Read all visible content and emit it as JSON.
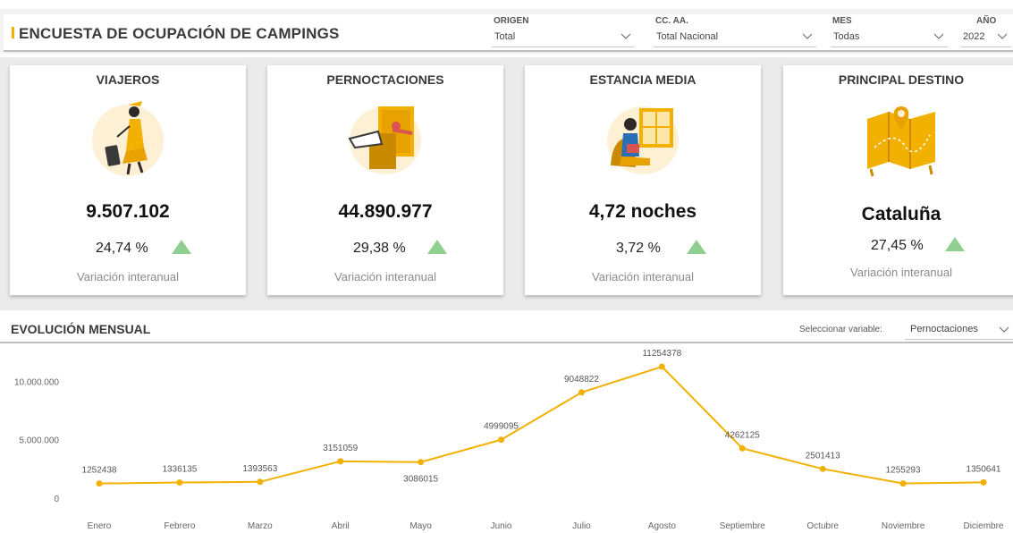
{
  "header": {
    "title": "ENCUESTA DE OCUPACIÓN DE CAMPINGS",
    "accent_color": "#F2B000"
  },
  "filters": {
    "origen": {
      "label": "ORIGEN",
      "value": "Total"
    },
    "ccaa": {
      "label": "CC. AA.",
      "value": "Total Nacional"
    },
    "mes": {
      "label": "MES",
      "value": "Todas"
    },
    "anio": {
      "label": "AÑO",
      "value": "2022"
    }
  },
  "kpis": [
    {
      "title": "VIAJEROS",
      "icon": "traveler-illustration",
      "value": "9.507.102",
      "pct": "24,74 %",
      "trend": "up",
      "sub": "Variación interanual"
    },
    {
      "title": "PERNOCTACIONES",
      "icon": "sleeping-person-illustration",
      "value": "44.890.977",
      "pct": "29,38 %",
      "trend": "up",
      "sub": "Variación interanual"
    },
    {
      "title": "ESTANCIA MEDIA",
      "icon": "reading-person-illustration",
      "value": "4,72 noches",
      "pct": "3,72 %",
      "trend": "up",
      "sub": "Variación interanual"
    },
    {
      "title": "PRINCIPAL DESTINO",
      "icon": "map-illustration",
      "value": "Cataluña",
      "pct": "27,45 %",
      "trend": "up",
      "sub": "Variación interanual"
    }
  ],
  "evolution": {
    "title": "EVOLUCIÓN MENSUAL",
    "selector_label": "Seleccionar variable:",
    "selector_value": "Pernoctaciones"
  },
  "chart_data": {
    "type": "line",
    "categories": [
      "Enero",
      "Febrero",
      "Marzo",
      "Abril",
      "Mayo",
      "Junio",
      "Julio",
      "Agosto",
      "Septiembre",
      "Octubre",
      "Noviembre",
      "Diciembre"
    ],
    "series": [
      {
        "values": [
          1252438,
          1336135,
          1393563,
          3151059,
          3086015,
          4999095,
          9048822,
          11254378,
          4262125,
          2501413,
          1255293,
          1350641
        ]
      }
    ],
    "data_labels": [
      "1252438",
      "1336135",
      "1393563",
      "3151059",
      "3086015",
      "4999095",
      "9048822",
      "11254378",
      "4262125",
      "2501413",
      "1255293",
      "1350641"
    ],
    "yticks": [
      0,
      5000000,
      10000000
    ],
    "ytick_labels": [
      "0",
      "5.000.000",
      "10.000.000"
    ],
    "ylim": [
      0,
      11254378
    ],
    "grid": false,
    "line_color": "#F2B000"
  }
}
